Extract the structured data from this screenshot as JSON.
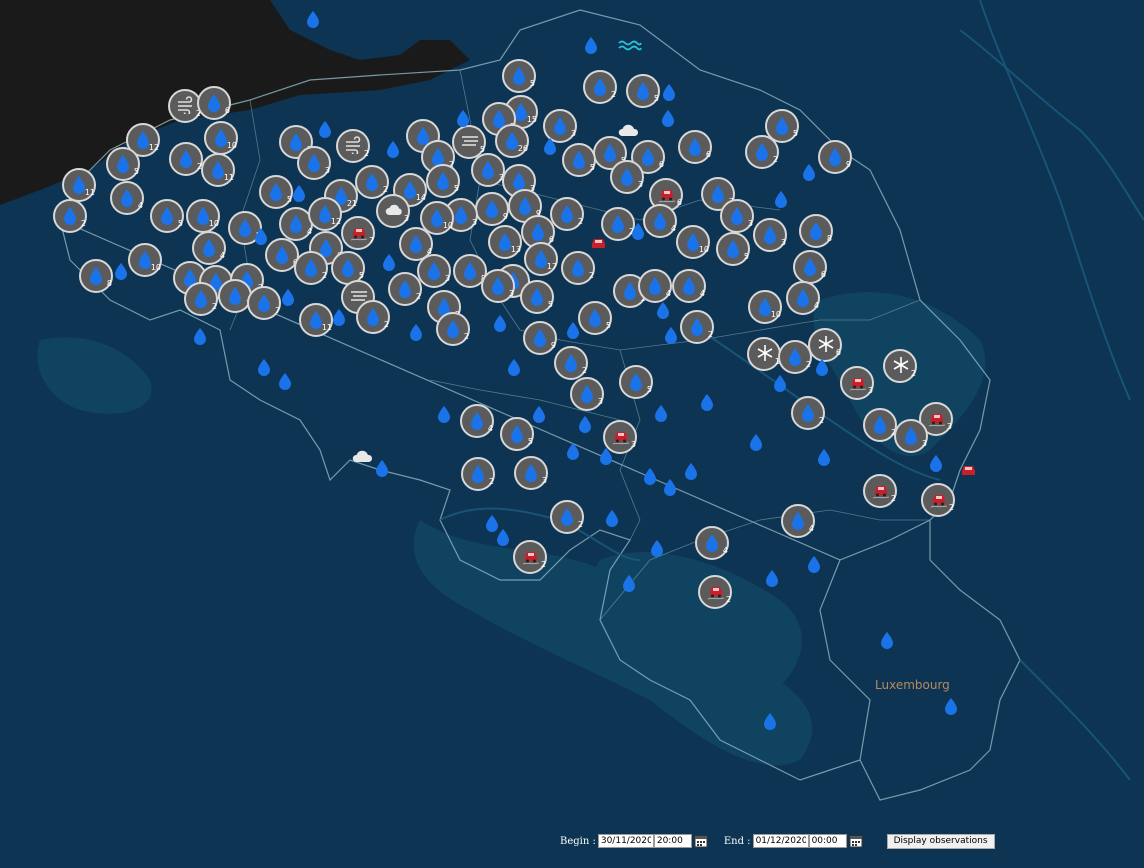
{
  "map": {
    "country_label": "Luxembourg",
    "colors": {
      "water": "#0d3452",
      "land_dark": "#1a1a1a",
      "border": "#8fb6c4",
      "marker_fill": "#5b5b5b",
      "drop_blue": "#1a73e8"
    }
  },
  "markers": [
    {
      "type": "rain",
      "count": "5"
    },
    {
      "type": "rain",
      "count": "2"
    },
    {
      "type": "rain",
      "count": "5"
    },
    {
      "type": "rain",
      "count": "15"
    },
    {
      "type": "wind",
      "count": "2"
    },
    {
      "type": "rain",
      "count": "6"
    },
    {
      "type": "rain",
      "count": "12"
    },
    {
      "type": "rain",
      "count": "10"
    },
    {
      "type": "rain",
      "count": "5"
    },
    {
      "type": "rain",
      "count": "2"
    },
    {
      "type": "rain",
      "count": "11"
    },
    {
      "type": "rain",
      "count": "11"
    },
    {
      "type": "rain",
      "count": "2"
    },
    {
      "type": "wind",
      "count": "2"
    },
    {
      "type": "rain",
      "count": "3"
    },
    {
      "type": "rain",
      "count": "3"
    },
    {
      "type": "fog",
      "count": "5"
    },
    {
      "type": "rain",
      "count": "5"
    },
    {
      "type": "rain",
      "count": "26"
    },
    {
      "type": "rain",
      "count": "3"
    },
    {
      "type": "rain",
      "count": "5"
    },
    {
      "type": "rain",
      "count": "2"
    },
    {
      "type": "rain",
      "count": "9"
    },
    {
      "type": "rain",
      "count": "6"
    },
    {
      "type": "rain",
      "count": "5"
    },
    {
      "type": "rain",
      "count": "6"
    },
    {
      "type": "rain",
      "count": "3"
    },
    {
      "type": "rain",
      "count": "5"
    },
    {
      "type": "rain",
      "count": "2"
    },
    {
      "type": "rain",
      "count": "4"
    },
    {
      "type": "rain",
      "count": "2"
    },
    {
      "type": "rain",
      "count": "5"
    },
    {
      "type": "rain",
      "count": "21"
    },
    {
      "type": "rain",
      "count": "2"
    },
    {
      "type": "rain",
      "count": "14"
    },
    {
      "type": "rain",
      "count": "5"
    },
    {
      "type": "rain",
      "count": "3"
    },
    {
      "type": "car",
      "count": "6"
    },
    {
      "type": "rain",
      "count": "3"
    },
    {
      "type": "cloud",
      "count": "3"
    },
    {
      "type": "rain",
      "count": "7"
    },
    {
      "type": "rain",
      "count": "3"
    },
    {
      "type": "rain",
      "count": "2"
    },
    {
      "type": "rain",
      "count": "9"
    },
    {
      "type": "rain",
      "count": "3"
    },
    {
      "type": "rain",
      "count": "10"
    },
    {
      "type": "rain",
      "count": "9"
    },
    {
      "type": "rain",
      "count": "4"
    },
    {
      "type": "rain",
      "count": "2"
    },
    {
      "type": "rain",
      "count": "10"
    },
    {
      "type": "rain",
      "count": "5"
    },
    {
      "type": "rain",
      "count": "5"
    },
    {
      "type": "rain",
      "count": "4"
    },
    {
      "type": "rain",
      "count": "12"
    },
    {
      "type": "car",
      "count": "7"
    },
    {
      "type": "rain",
      "count": "3"
    },
    {
      "type": "rain",
      "count": "8"
    },
    {
      "type": "rain",
      "count": "10"
    },
    {
      "type": "rain",
      "count": "5"
    },
    {
      "type": "rain",
      "count": "10"
    },
    {
      "type": "rain",
      "count": "4"
    },
    {
      "type": "rain",
      "count": "6"
    },
    {
      "type": "rain",
      "count": "6"
    },
    {
      "type": "rain",
      "count": "4"
    },
    {
      "type": "rain",
      "count": "13"
    },
    {
      "type": "rain",
      "count": "6"
    },
    {
      "type": "rain",
      "count": "17"
    },
    {
      "type": "rain",
      "count": "8"
    },
    {
      "type": "rain",
      "count": "5"
    },
    {
      "type": "rain",
      "count": "6"
    },
    {
      "type": "rain",
      "count": "2"
    },
    {
      "type": "rain",
      "count": "2"
    },
    {
      "type": "rain",
      "count": "5"
    },
    {
      "type": "rain",
      "count": "3"
    },
    {
      "type": "rain",
      "count": "8"
    },
    {
      "type": "rain",
      "count": "6"
    },
    {
      "type": "rain",
      "count": "2"
    },
    {
      "type": "rain",
      "count": "3"
    },
    {
      "type": "rain",
      "count": "5"
    },
    {
      "type": "rain",
      "count": "2"
    },
    {
      "type": "rain",
      "count": "2"
    },
    {
      "type": "rain",
      "count": "4"
    },
    {
      "type": "rain",
      "count": "4"
    },
    {
      "type": "rain",
      "count": "6"
    },
    {
      "type": "rain",
      "count": "2"
    },
    {
      "type": "rain",
      "count": "3"
    },
    {
      "type": "rain",
      "count": "7"
    },
    {
      "type": "rain",
      "count": "11"
    },
    {
      "type": "fog",
      "count": "3"
    },
    {
      "type": "rain",
      "count": "2"
    },
    {
      "type": "rain",
      "count": "2"
    },
    {
      "type": "rain",
      "count": "2"
    },
    {
      "type": "rain",
      "count": "5"
    },
    {
      "type": "rain",
      "count": "2"
    },
    {
      "type": "rain",
      "count": "10"
    },
    {
      "type": "rain",
      "count": "4"
    },
    {
      "type": "rain",
      "count": "9"
    },
    {
      "type": "snow",
      "count": "6"
    },
    {
      "type": "snow",
      "count": "1"
    },
    {
      "type": "rain",
      "count": "2"
    },
    {
      "type": "rain",
      "count": "2"
    },
    {
      "type": "snow",
      "count": "2"
    },
    {
      "type": "car",
      "count": "3"
    },
    {
      "type": "rain",
      "count": "5"
    },
    {
      "type": "rain",
      "count": "3"
    },
    {
      "type": "rain",
      "count": "2"
    },
    {
      "type": "rain",
      "count": "4"
    },
    {
      "type": "rain",
      "count": "2"
    },
    {
      "type": "rain",
      "count": "5"
    },
    {
      "type": "car",
      "count": "3"
    },
    {
      "type": "car",
      "count": "3"
    },
    {
      "type": "rain",
      "count": "3"
    },
    {
      "type": "rain",
      "count": "2"
    },
    {
      "type": "rain",
      "count": "3"
    },
    {
      "type": "car",
      "count": "2"
    },
    {
      "type": "car",
      "count": "2"
    },
    {
      "type": "rain",
      "count": "2"
    },
    {
      "type": "rain",
      "count": "4"
    },
    {
      "type": "rain",
      "count": "4"
    },
    {
      "type": "car",
      "count": "2"
    },
    {
      "type": "car",
      "count": "2"
    }
  ],
  "observation_bar": {
    "begin_label": "Begin :",
    "begin_date": "30/11/2020",
    "begin_time": "20:00",
    "end_label": "End :",
    "end_date": "01/12/2020",
    "end_time": "00:00",
    "display_button": "Display observations"
  }
}
